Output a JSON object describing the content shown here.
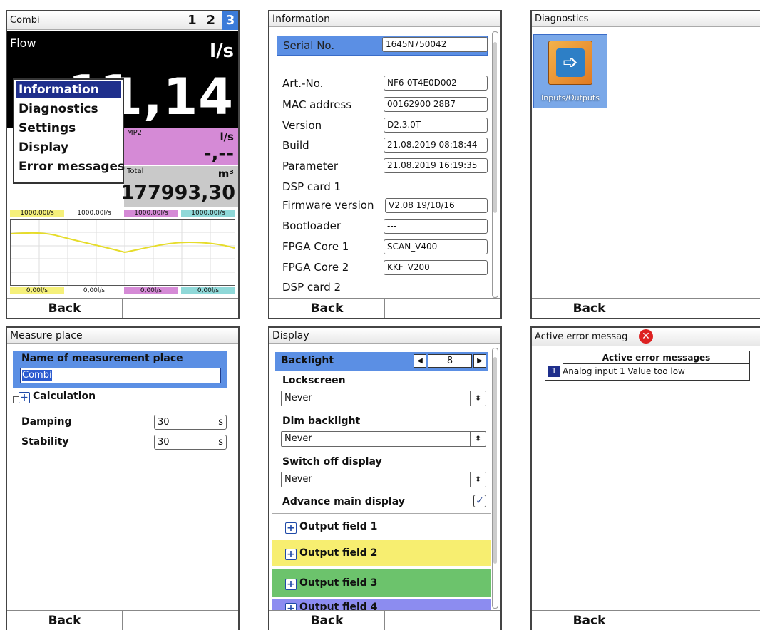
{
  "p1": {
    "title": "Combi",
    "pages": [
      "1",
      "2",
      "3"
    ],
    "flow_label": "Flow",
    "flow_unit": "l/s",
    "flow_value": "1,14",
    "flow_value_hidden": "11",
    "mp2_label": "MP2",
    "mp2_unit": "l/s",
    "mp2_value": "-,--",
    "total_label": "Total",
    "total_unit": "m³",
    "total_value": "177993,30",
    "top_scale": [
      "1000,00l/s",
      "1000,00l/s",
      "1000,00l/s",
      "1000,00l/s"
    ],
    "bottom_scale": [
      "0,00l/s",
      "0,00l/s",
      "0,00l/s",
      "0,00l/s"
    ],
    "scale_colors": [
      "#f5f07a",
      "#ffffff",
      "#d58ad6",
      "#8fd8d8"
    ],
    "menu": [
      "Information",
      "Diagnostics",
      "Settings",
      "Display",
      "Error messages"
    ],
    "back": "Back"
  },
  "p2": {
    "title": "Information",
    "rows": [
      {
        "label": "Serial No.",
        "value": "1645N750042"
      },
      {
        "label": "Art.-No.",
        "value": "NF6-0T4E0D002"
      },
      {
        "label": "MAC address",
        "value": "00162900 28B7"
      },
      {
        "label": "Version",
        "value": "D2.3.0T"
      },
      {
        "label": "Build",
        "value": "21.08.2019 08:18:44"
      },
      {
        "label": "Parameter",
        "value": "21.08.2019 16:19:35"
      },
      {
        "label": "DSP card 1",
        "value": ""
      },
      {
        "label": "Firmware version",
        "value": "V2.08 19/10/16"
      },
      {
        "label": "Bootloader",
        "value": "---"
      },
      {
        "label": "FPGA Core 1",
        "value": "SCAN_V400"
      },
      {
        "label": "FPGA Core 2",
        "value": "KKF_V200"
      },
      {
        "label": "DSP card 2",
        "value": ""
      }
    ],
    "back": "Back"
  },
  "p3": {
    "title": "Diagnostics",
    "icon_label": "Inputs/Outputs",
    "back": "Back"
  },
  "p4": {
    "title": "Measure place",
    "name_label": "Name of measurement place",
    "name_value": "Combi",
    "calc_label": "Calculation",
    "damping_label": "Damping",
    "damping_value": "30",
    "damping_unit": "s",
    "stability_label": "Stability",
    "stability_value": "30",
    "stability_unit": "s",
    "back": "Back"
  },
  "p5": {
    "title": "Display",
    "backlight_label": "Backlight",
    "backlight_value": "8",
    "lockscreen_label": "Lockscreen",
    "lockscreen_value": "Never",
    "dim_label": "Dim backlight",
    "dim_value": "Never",
    "switchoff_label": "Switch off display",
    "switchoff_value": "Never",
    "advance_label": "Advance main display",
    "output_fields": [
      {
        "label": "Output field 1",
        "color": "#ffffff"
      },
      {
        "label": "Output field 2",
        "color": "#f7ee70"
      },
      {
        "label": "Output field 3",
        "color": "#6cc36c"
      },
      {
        "label": "Output field 4",
        "color": "#8c8cf0"
      }
    ],
    "back": "Back"
  },
  "p6": {
    "title": "Active error messag",
    "table_header": "Active error messages",
    "error_index": "1",
    "error_text": "Analog input 1 Value too low",
    "back": "Back"
  }
}
